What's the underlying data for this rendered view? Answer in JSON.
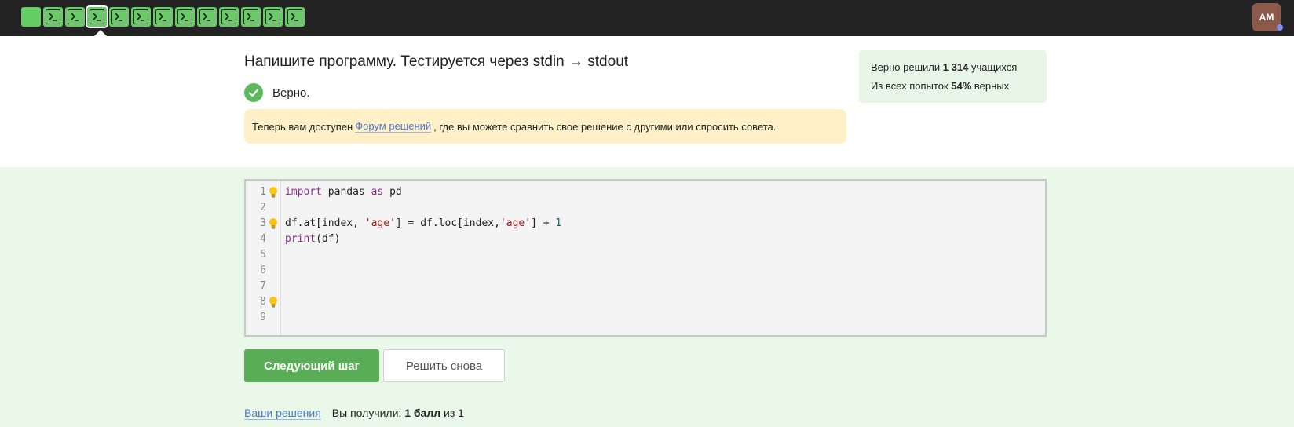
{
  "topbar": {
    "avatar_initials": "AM",
    "steps": [
      {
        "icon": "solid-square-icon",
        "status": "passed"
      },
      {
        "icon": "terminal-icon",
        "status": "passed"
      },
      {
        "icon": "terminal-icon",
        "status": "passed"
      },
      {
        "icon": "terminal-icon",
        "status": "current"
      },
      {
        "icon": "terminal-icon",
        "status": "passed"
      },
      {
        "icon": "terminal-icon",
        "status": "passed"
      },
      {
        "icon": "terminal-icon",
        "status": "passed"
      },
      {
        "icon": "terminal-icon",
        "status": "passed"
      },
      {
        "icon": "terminal-icon",
        "status": "passed"
      },
      {
        "icon": "terminal-icon",
        "status": "passed"
      },
      {
        "icon": "terminal-icon",
        "status": "passed"
      },
      {
        "icon": "terminal-icon",
        "status": "passed"
      },
      {
        "icon": "terminal-icon",
        "status": "passed"
      }
    ]
  },
  "task": {
    "title": "Напишите программу. Тестируется через stdin → stdout",
    "verdict": "Верно."
  },
  "notice": {
    "before": "Теперь вам доступен",
    "link": "Форум решений",
    "after": ", где вы можете сравнить свое решение с другими или спросить совета."
  },
  "stats": {
    "line1_prefix": "Верно решили",
    "line1_count": "1 314",
    "line1_suffix": "учащихся",
    "line2_prefix": "Из всех попыток",
    "line2_percent": "54%",
    "line2_suffix": "верных"
  },
  "editor": {
    "line_numbers": [
      "1",
      "2",
      "3",
      "4",
      "5",
      "6",
      "7",
      "8",
      "9"
    ],
    "hint_lines": [
      1,
      3,
      8
    ]
  },
  "buttons": {
    "next_step": "Следующий шаг",
    "solve_again": "Решить снова"
  },
  "footer": {
    "solutions_link": "Ваши решения",
    "score_prefix": "Вы получили:",
    "score_value": "1 балл",
    "score_suffix": "из 1"
  },
  "colors": {
    "accent_green": "#5aad57",
    "step_green": "#66cc66",
    "page_green_bg": "#e9f8e9",
    "notice_bg": "#fff0c8",
    "link_blue": "#4a7ad0",
    "topbar_bg": "#232323"
  }
}
